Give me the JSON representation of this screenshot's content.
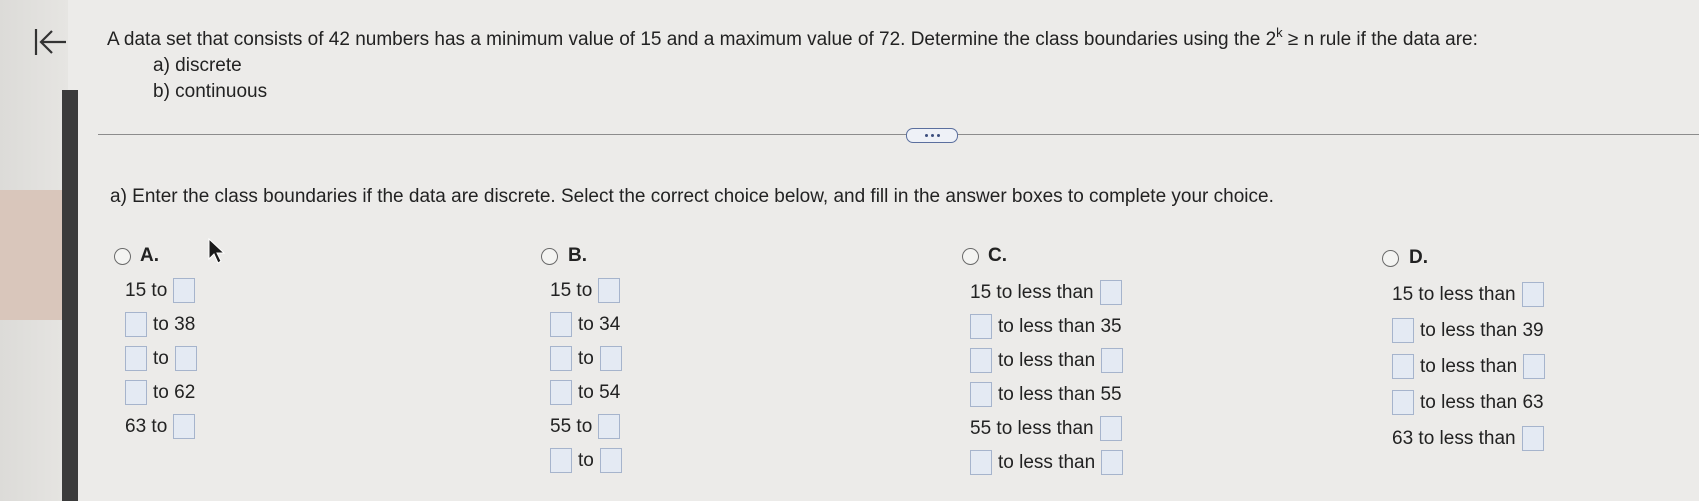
{
  "question": {
    "text_before_sup": "A data set that consists of 42 numbers has a minimum value of 15 and a maximum value of 72. Determine the class boundaries using the 2",
    "sup": "k",
    "text_after_sup": " ≥ n rule if the data are:",
    "part_a": "a) discrete",
    "part_b": "b) continuous"
  },
  "prompt": "a) Enter the class boundaries if the data are discrete. Select the correct choice below, and fill in the answer boxes to complete your choice.",
  "choices": {
    "A": {
      "label": "A.",
      "rows": [
        {
          "left": "15 to",
          "right": ""
        },
        {
          "left": "",
          "right": "to 38"
        },
        {
          "left": "",
          "right": "to"
        },
        {
          "left": "",
          "right": "to 62"
        },
        {
          "left": "63 to",
          "right": ""
        }
      ]
    },
    "B": {
      "label": "B.",
      "rows": [
        {
          "left": "15 to",
          "right": ""
        },
        {
          "left": "",
          "right": "to 34"
        },
        {
          "left": "",
          "right": "to"
        },
        {
          "left": "",
          "right": "to 54"
        },
        {
          "left": "55 to",
          "right": ""
        },
        {
          "left": "",
          "right": "to"
        }
      ]
    },
    "C": {
      "label": "C.",
      "rows": [
        {
          "left": "15 to less than",
          "right": ""
        },
        {
          "left": "",
          "right": "to less than 35"
        },
        {
          "left": "",
          "right": "to less than"
        },
        {
          "left": "",
          "right": "to less than 55"
        },
        {
          "left": "55 to less than",
          "right": ""
        },
        {
          "left": "",
          "right": "to less than"
        }
      ]
    },
    "D": {
      "label": "D.",
      "rows": [
        {
          "left": "15 to less than",
          "right": ""
        },
        {
          "left": "",
          "right": "to less than 39"
        },
        {
          "left": "",
          "right": "to less than"
        },
        {
          "left": "",
          "right": "to less than 63"
        },
        {
          "left": "63 to less than",
          "right": ""
        }
      ]
    }
  }
}
